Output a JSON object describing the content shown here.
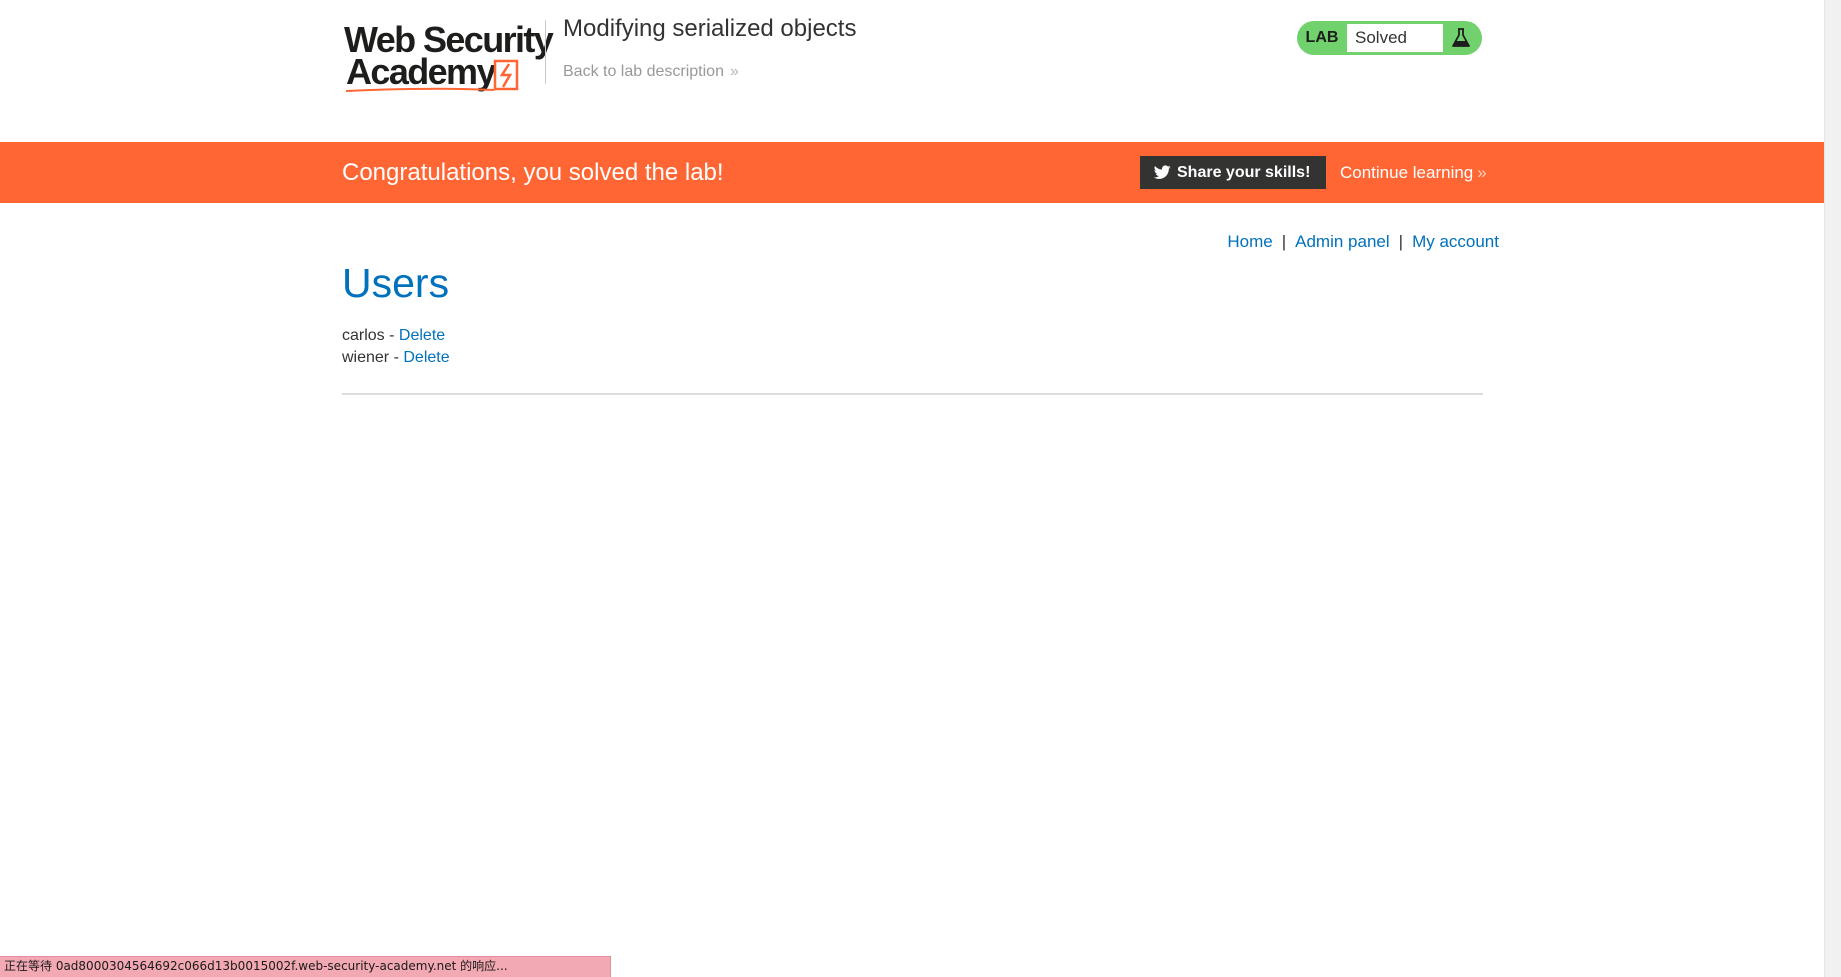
{
  "header": {
    "logo_line1": "Web Security",
    "logo_line2": "Academy",
    "lab_title": "Modifying serialized objects",
    "back_link": "Back to lab description",
    "back_chevron": "»"
  },
  "lab_status": {
    "label": "LAB",
    "state": "Solved",
    "icon": "flask-icon",
    "color": "#70d16d"
  },
  "banner": {
    "message": "Congratulations, you solved the lab!",
    "share_label": "Share your skills!",
    "continue_label": "Continue learning",
    "continue_chevron": "»",
    "color": "#ff6633"
  },
  "nav": {
    "items": [
      {
        "label": "Home"
      },
      {
        "label": "Admin panel"
      },
      {
        "label": "My account"
      }
    ],
    "separator": "|"
  },
  "main": {
    "title": "Users",
    "users": [
      {
        "name": "carlos",
        "dash": "-",
        "action": "Delete"
      },
      {
        "name": "wiener",
        "dash": "-",
        "action": "Delete"
      }
    ]
  },
  "browser_status": {
    "text": "正在等待 0ad8000304564692c066d13b0015002f.web-security-academy.net 的响应..."
  },
  "colors": {
    "accent_link": "#0071bc",
    "brand_orange": "#ff6633",
    "solved_green": "#70d16d"
  }
}
